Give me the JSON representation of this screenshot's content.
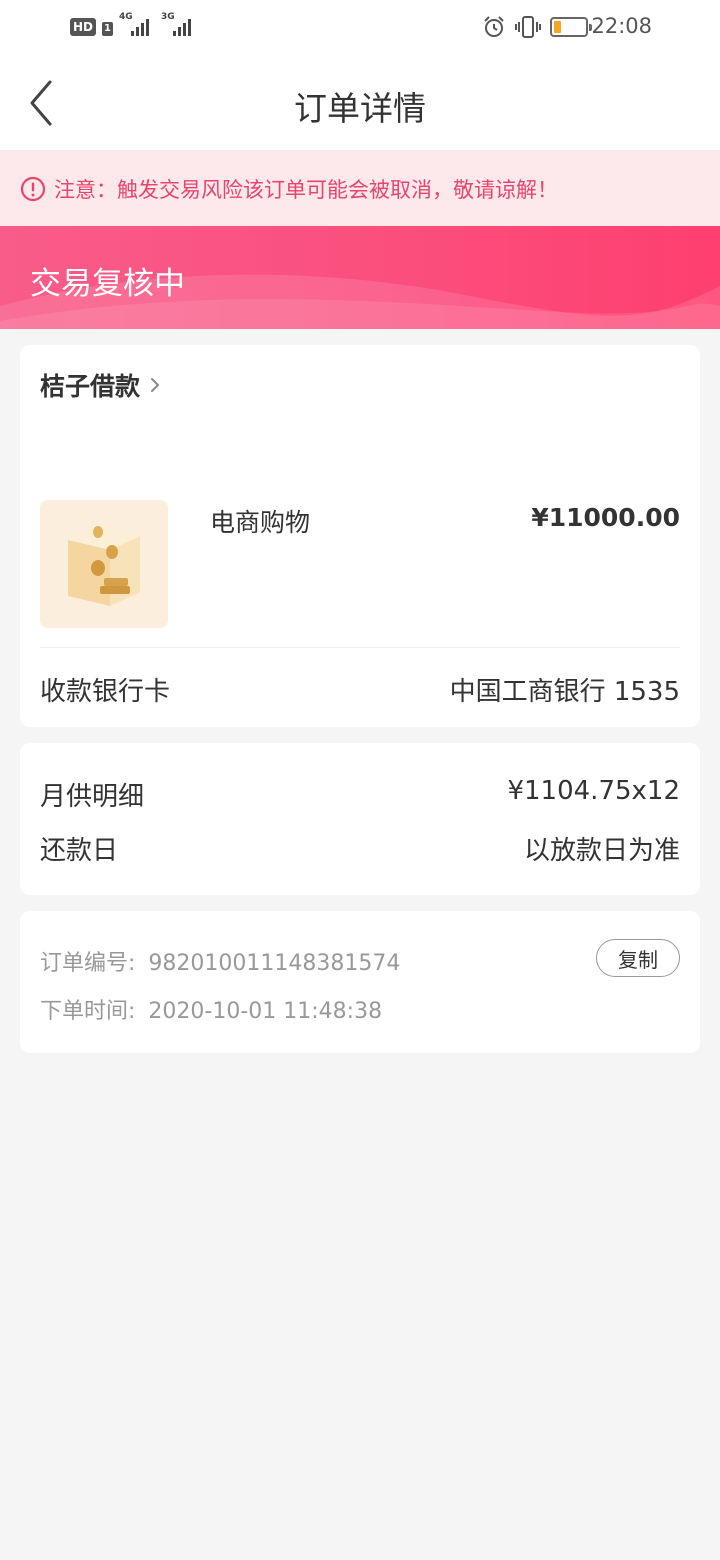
{
  "status_bar": {
    "hd_label": "HD",
    "sim_label": "1",
    "net1_label": "4G",
    "net2_label": "3G",
    "time": "22:08",
    "icons": [
      "alarm-icon",
      "vibrate-icon",
      "battery-icon"
    ],
    "battery_level": 0.2
  },
  "nav": {
    "title": "订单详情",
    "back_icon": "chevron-left-icon"
  },
  "notice": {
    "icon": "alert-circle-icon",
    "text": "注意：触发交易风险该订单可能会被取消，敬请谅解！",
    "color": "#e8456c"
  },
  "banner": {
    "status": "交易复核中",
    "gradient": [
      "#f95c88",
      "#fe3f6f"
    ]
  },
  "order": {
    "merchant": "桔子借款",
    "product_name": "电商购物",
    "price": "¥11000.00",
    "bank_label": "收款银行卡",
    "bank_value": "中国工商银行 1535"
  },
  "repayment": {
    "monthly_label": "月供明细",
    "monthly_value": "¥1104.75x12",
    "due_label": "还款日",
    "due_value": "以放款日为准"
  },
  "meta": {
    "order_no_label": "订单编号:",
    "order_no": "982010011148381574",
    "order_time_label": "下单时间:",
    "order_time": "2020-10-01 11:48:38",
    "copy_label": "复制"
  }
}
